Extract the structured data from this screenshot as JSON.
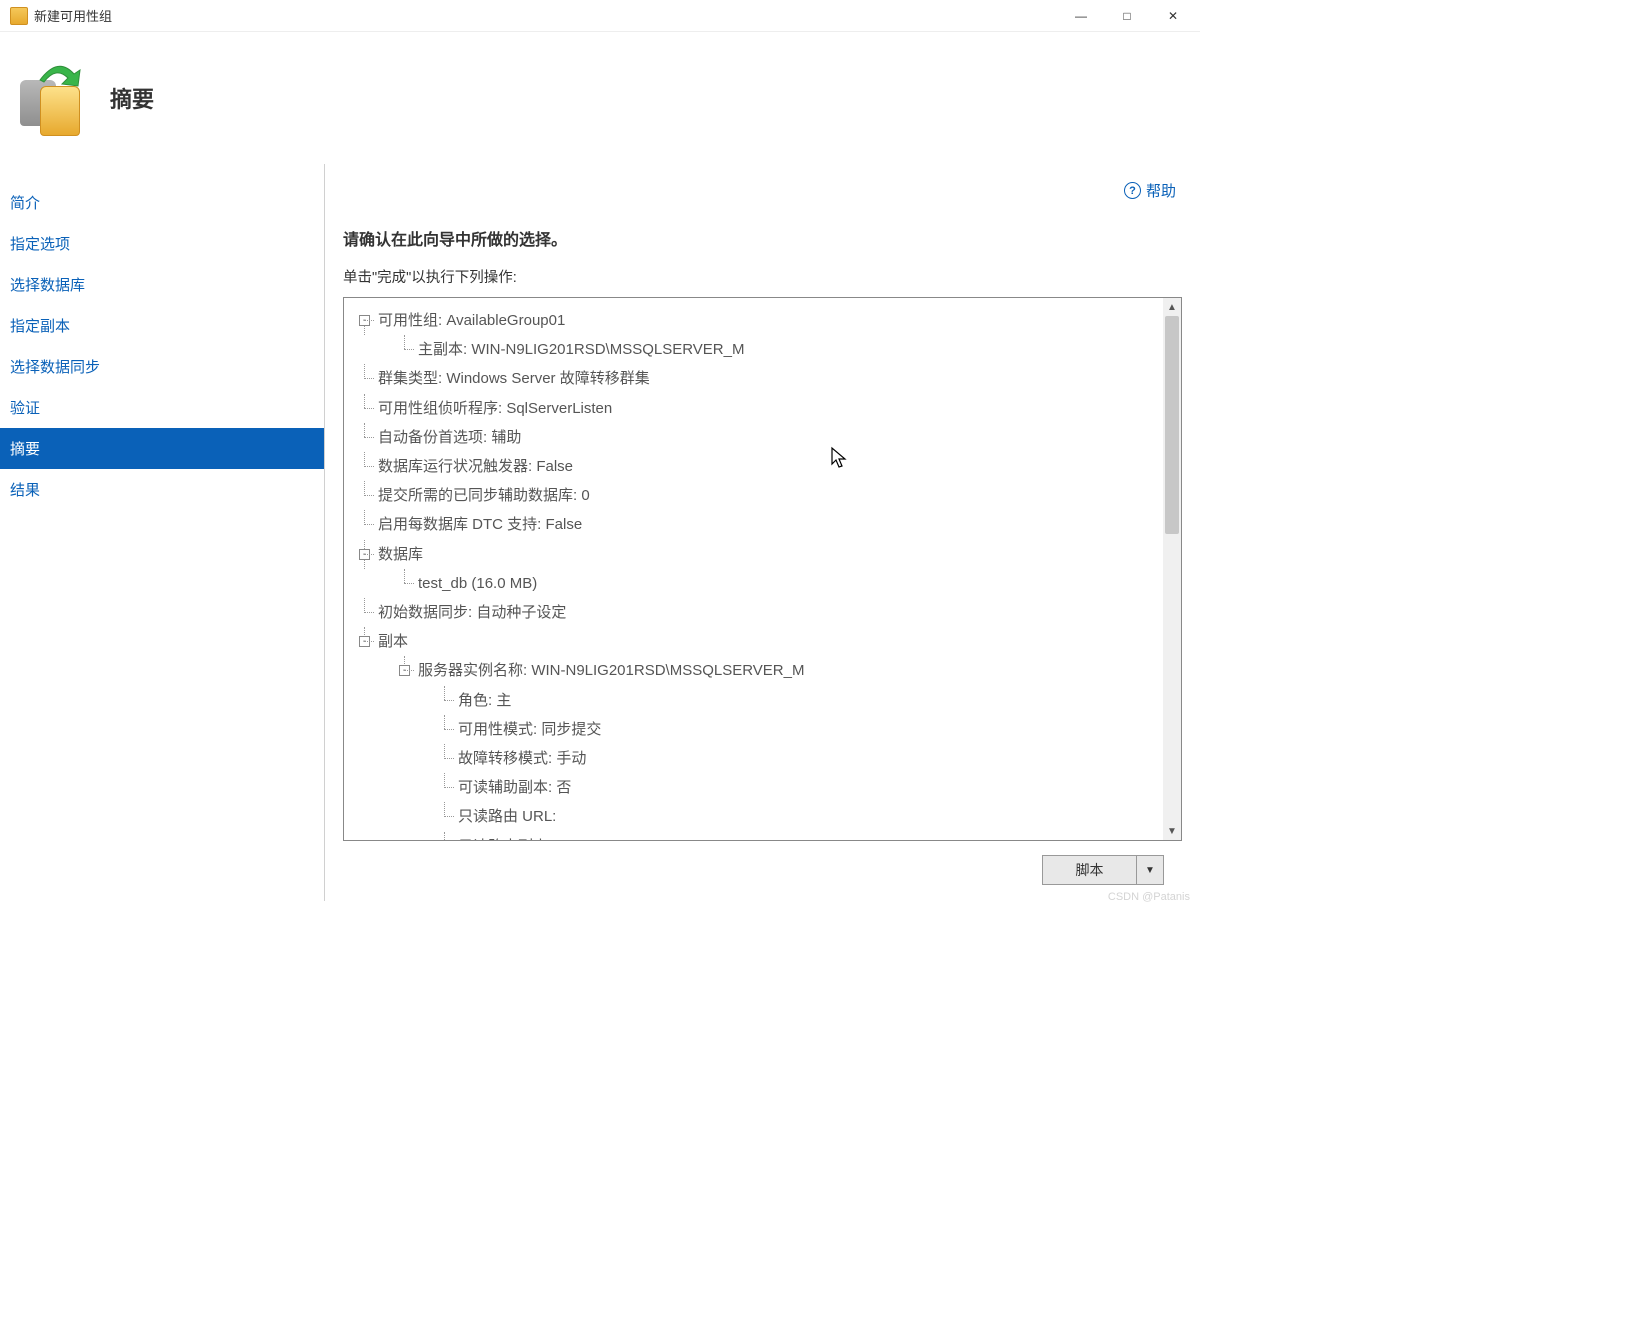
{
  "window": {
    "title": "新建可用性组"
  },
  "header": {
    "title": "摘要"
  },
  "help_label": "帮助",
  "sidebar": {
    "items": [
      {
        "label": "简介"
      },
      {
        "label": "指定选项"
      },
      {
        "label": "选择数据库"
      },
      {
        "label": "指定副本"
      },
      {
        "label": "选择数据同步"
      },
      {
        "label": "验证"
      },
      {
        "label": "摘要"
      },
      {
        "label": "结果"
      }
    ],
    "selected_index": 6
  },
  "main": {
    "heading": "请确认在此向导中所做的选择。",
    "subline": "单击\"完成\"以执行下列操作:"
  },
  "tree": {
    "ag_label": "可用性组: AvailableGroup01",
    "primary_replica": "主副本: WIN-N9LIG201RSD\\MSSQLSERVER_M",
    "cluster_type": "群集类型: Windows Server 故障转移群集",
    "listener": "可用性组侦听程序: SqlServerListen",
    "backup_pref": "自动备份首选项: 辅助",
    "db_health_trigger": "数据库运行状况触发器: False",
    "required_synced": "提交所需的已同步辅助数据库: 0",
    "dtc_support": "启用每数据库 DTC 支持: False",
    "databases_label": "数据库",
    "database_item": "test_db (16.0 MB)",
    "initial_sync": "初始数据同步: 自动种子设定",
    "replicas_label": "副本",
    "server_instance": "服务器实例名称: WIN-N9LIG201RSD\\MSSQLSERVER_M",
    "role": "角色: 主",
    "availability_mode": "可用性模式: 同步提交",
    "failover_mode": "故障转移模式: 手动",
    "readable_secondary": "可读辅助副本: 否",
    "readonly_routing_url": "只读路由 URL:",
    "readonly_routing_list": "只读路由列表:"
  },
  "footer": {
    "script_button": "脚本"
  },
  "watermark": "CSDN @Patanis"
}
